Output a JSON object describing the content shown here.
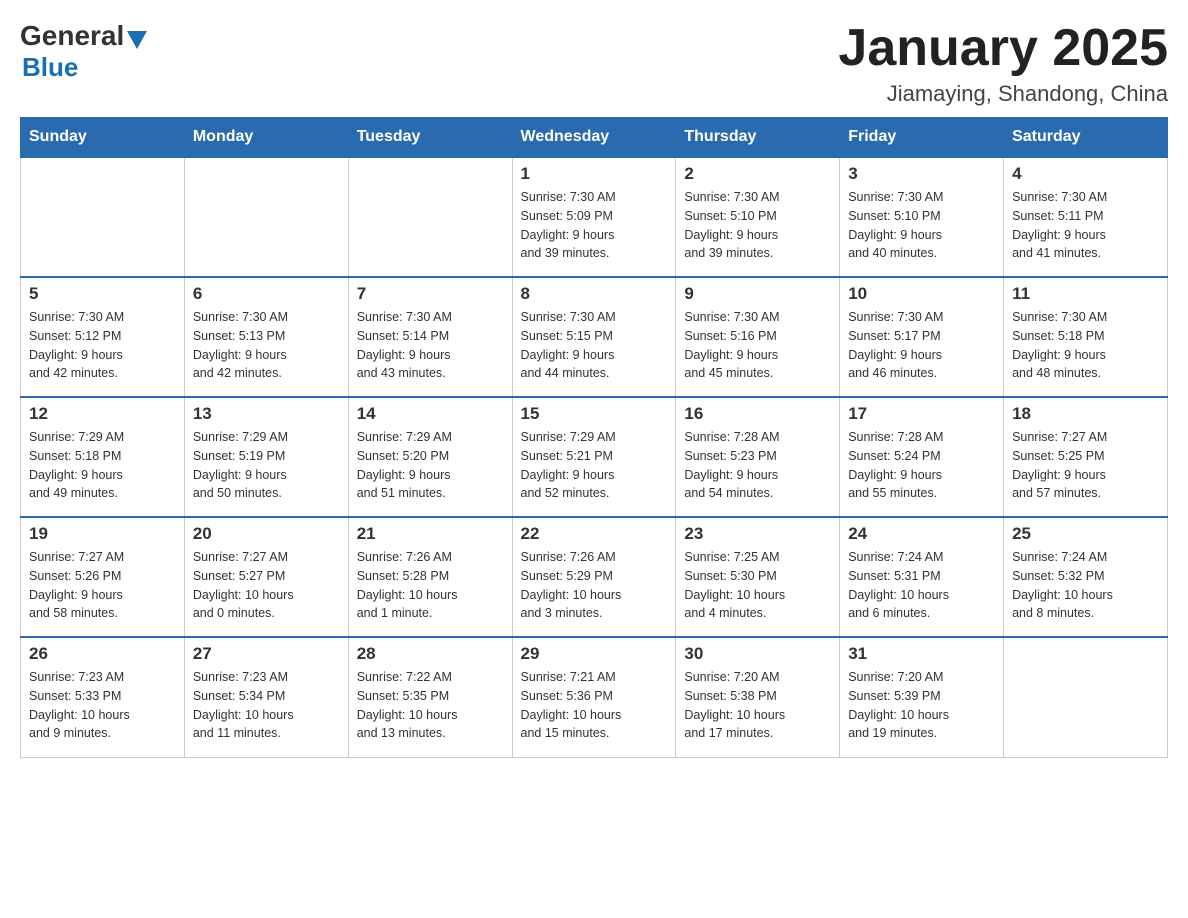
{
  "logo": {
    "general": "General",
    "triangle": "▲",
    "blue": "Blue"
  },
  "header": {
    "title": "January 2025",
    "subtitle": "Jiamaying, Shandong, China"
  },
  "weekdays": [
    "Sunday",
    "Monday",
    "Tuesday",
    "Wednesday",
    "Thursday",
    "Friday",
    "Saturday"
  ],
  "weeks": [
    [
      {
        "day": "",
        "info": ""
      },
      {
        "day": "",
        "info": ""
      },
      {
        "day": "",
        "info": ""
      },
      {
        "day": "1",
        "info": "Sunrise: 7:30 AM\nSunset: 5:09 PM\nDaylight: 9 hours\nand 39 minutes."
      },
      {
        "day": "2",
        "info": "Sunrise: 7:30 AM\nSunset: 5:10 PM\nDaylight: 9 hours\nand 39 minutes."
      },
      {
        "day": "3",
        "info": "Sunrise: 7:30 AM\nSunset: 5:10 PM\nDaylight: 9 hours\nand 40 minutes."
      },
      {
        "day": "4",
        "info": "Sunrise: 7:30 AM\nSunset: 5:11 PM\nDaylight: 9 hours\nand 41 minutes."
      }
    ],
    [
      {
        "day": "5",
        "info": "Sunrise: 7:30 AM\nSunset: 5:12 PM\nDaylight: 9 hours\nand 42 minutes."
      },
      {
        "day": "6",
        "info": "Sunrise: 7:30 AM\nSunset: 5:13 PM\nDaylight: 9 hours\nand 42 minutes."
      },
      {
        "day": "7",
        "info": "Sunrise: 7:30 AM\nSunset: 5:14 PM\nDaylight: 9 hours\nand 43 minutes."
      },
      {
        "day": "8",
        "info": "Sunrise: 7:30 AM\nSunset: 5:15 PM\nDaylight: 9 hours\nand 44 minutes."
      },
      {
        "day": "9",
        "info": "Sunrise: 7:30 AM\nSunset: 5:16 PM\nDaylight: 9 hours\nand 45 minutes."
      },
      {
        "day": "10",
        "info": "Sunrise: 7:30 AM\nSunset: 5:17 PM\nDaylight: 9 hours\nand 46 minutes."
      },
      {
        "day": "11",
        "info": "Sunrise: 7:30 AM\nSunset: 5:18 PM\nDaylight: 9 hours\nand 48 minutes."
      }
    ],
    [
      {
        "day": "12",
        "info": "Sunrise: 7:29 AM\nSunset: 5:18 PM\nDaylight: 9 hours\nand 49 minutes."
      },
      {
        "day": "13",
        "info": "Sunrise: 7:29 AM\nSunset: 5:19 PM\nDaylight: 9 hours\nand 50 minutes."
      },
      {
        "day": "14",
        "info": "Sunrise: 7:29 AM\nSunset: 5:20 PM\nDaylight: 9 hours\nand 51 minutes."
      },
      {
        "day": "15",
        "info": "Sunrise: 7:29 AM\nSunset: 5:21 PM\nDaylight: 9 hours\nand 52 minutes."
      },
      {
        "day": "16",
        "info": "Sunrise: 7:28 AM\nSunset: 5:23 PM\nDaylight: 9 hours\nand 54 minutes."
      },
      {
        "day": "17",
        "info": "Sunrise: 7:28 AM\nSunset: 5:24 PM\nDaylight: 9 hours\nand 55 minutes."
      },
      {
        "day": "18",
        "info": "Sunrise: 7:27 AM\nSunset: 5:25 PM\nDaylight: 9 hours\nand 57 minutes."
      }
    ],
    [
      {
        "day": "19",
        "info": "Sunrise: 7:27 AM\nSunset: 5:26 PM\nDaylight: 9 hours\nand 58 minutes."
      },
      {
        "day": "20",
        "info": "Sunrise: 7:27 AM\nSunset: 5:27 PM\nDaylight: 10 hours\nand 0 minutes."
      },
      {
        "day": "21",
        "info": "Sunrise: 7:26 AM\nSunset: 5:28 PM\nDaylight: 10 hours\nand 1 minute."
      },
      {
        "day": "22",
        "info": "Sunrise: 7:26 AM\nSunset: 5:29 PM\nDaylight: 10 hours\nand 3 minutes."
      },
      {
        "day": "23",
        "info": "Sunrise: 7:25 AM\nSunset: 5:30 PM\nDaylight: 10 hours\nand 4 minutes."
      },
      {
        "day": "24",
        "info": "Sunrise: 7:24 AM\nSunset: 5:31 PM\nDaylight: 10 hours\nand 6 minutes."
      },
      {
        "day": "25",
        "info": "Sunrise: 7:24 AM\nSunset: 5:32 PM\nDaylight: 10 hours\nand 8 minutes."
      }
    ],
    [
      {
        "day": "26",
        "info": "Sunrise: 7:23 AM\nSunset: 5:33 PM\nDaylight: 10 hours\nand 9 minutes."
      },
      {
        "day": "27",
        "info": "Sunrise: 7:23 AM\nSunset: 5:34 PM\nDaylight: 10 hours\nand 11 minutes."
      },
      {
        "day": "28",
        "info": "Sunrise: 7:22 AM\nSunset: 5:35 PM\nDaylight: 10 hours\nand 13 minutes."
      },
      {
        "day": "29",
        "info": "Sunrise: 7:21 AM\nSunset: 5:36 PM\nDaylight: 10 hours\nand 15 minutes."
      },
      {
        "day": "30",
        "info": "Sunrise: 7:20 AM\nSunset: 5:38 PM\nDaylight: 10 hours\nand 17 minutes."
      },
      {
        "day": "31",
        "info": "Sunrise: 7:20 AM\nSunset: 5:39 PM\nDaylight: 10 hours\nand 19 minutes."
      },
      {
        "day": "",
        "info": ""
      }
    ]
  ]
}
